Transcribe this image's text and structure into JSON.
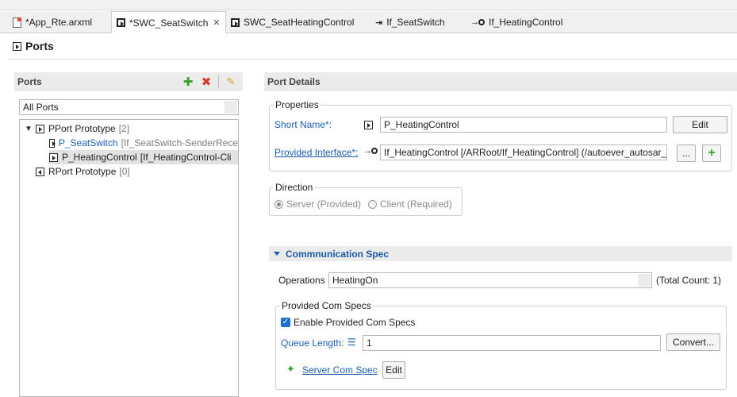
{
  "tabs": [
    {
      "label": "*App_Rte.arxml",
      "icon": "arxml-file-icon"
    },
    {
      "label": "*SWC_SeatSwitch",
      "icon": "component-icon",
      "active": true
    },
    {
      "label": "SWC_SeatHeatingControl",
      "icon": "component-icon"
    },
    {
      "label": "If_SeatSwitch",
      "icon": "sender-receiver-interface-icon"
    },
    {
      "label": "If_HeatingControl",
      "icon": "client-server-interface-icon"
    }
  ],
  "page": {
    "title": "Ports"
  },
  "ports_panel": {
    "header": "Ports",
    "filter_value": "All Ports",
    "tree": {
      "pport": {
        "label": "PPort Prototype",
        "count": "[2]"
      },
      "items": [
        {
          "name": "P_SeatSwitch",
          "detail": "[If_SeatSwitch-SenderRece"
        },
        {
          "name": "P_HeatingControl",
          "detail": "[If_HeatingControl-Cli"
        }
      ],
      "rport": {
        "label": "RPort Prototype",
        "count": "[0]"
      }
    }
  },
  "details": {
    "header": "Port Details",
    "properties": {
      "legend": "Properties",
      "short_name_label": "Short Name*:",
      "short_name_value": "P_HeatingControl",
      "edit_label": "Edit",
      "provided_interface_label": "Provided Interface*:",
      "provided_interface_value": "If_HeatingControl [/ARRoot/If_HeatingControl] (/autoever_autosar_",
      "browse_label": "...",
      "add_label": "+"
    },
    "direction": {
      "legend": "Direction",
      "server_label": "Server (Provided)",
      "client_label": "Client (Required)",
      "selected": "server"
    },
    "comm_spec": {
      "title": "Commnunication Spec",
      "operations_label": "Operations",
      "operations_value": "HeatingOn",
      "total_count": "(Total Count: 1)",
      "provided_legend": "Provided Com Specs",
      "enable_label": "Enable Provided Com Specs",
      "enable_checked": true,
      "queue_label": "Queue Length:",
      "queue_value": "1",
      "convert_label": "Convert...",
      "server_spec_label": "Server Com Spec",
      "server_spec_edit": "Edit"
    }
  },
  "colors": {
    "link": "#1a5fb4",
    "header_bg": "#ebebeb",
    "section_text": "#1c5aa8",
    "delete_red": "#d83a2a",
    "add_green": "#3aa12e"
  }
}
